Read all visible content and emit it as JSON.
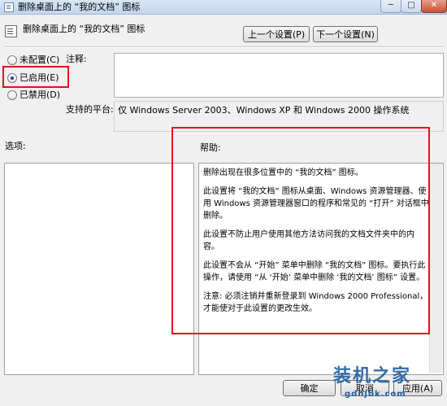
{
  "window": {
    "title": "删除桌面上的 “我的文档” 图标",
    "min_glyph": "─",
    "max_glyph": "□",
    "close_glyph": "✕"
  },
  "header": {
    "title": "删除桌面上的 “我的文档” 图标",
    "prev_label": "上一个设置(P)",
    "next_label": "下一个设置(N)"
  },
  "radios": [
    {
      "label": "未配置(C)",
      "selected": false
    },
    {
      "label": "已启用(E)",
      "selected": true
    },
    {
      "label": "已禁用(D)",
      "selected": false
    }
  ],
  "comment": {
    "label": "注释:",
    "value": ""
  },
  "platform": {
    "label": "支持的平台:",
    "value": "仅 Windows Server 2003、Windows XP 和 Windows 2000 操作系统"
  },
  "options": {
    "label": "选项:"
  },
  "help": {
    "label": "帮助:",
    "paragraphs": [
      "删除出现在很多位置中的 “我的文档” 图标。",
      "此设置将 “我的文档” 图标从桌面、Windows 资源管理器、使用 Windows 资源管理器窗口的程序和常见的 “打开” 对话框中删除。",
      "此设置不防止用户使用其他方法访问我的文档文件夹中的内容。",
      "此设置不会从 “开始” 菜单中删除 “我的文档” 图标。要执行此操作，请使用 “从 ‘开始’ 菜单中删除 ‘我的文档’ 图标” 设置。",
      "注意: 必须注销并重新登录到 Windows 2000 Professional，才能使对于此设置的更改生效。"
    ]
  },
  "footer": {
    "ok_label": "确定",
    "cancel_label": "取消",
    "apply_label": "应用(A)"
  },
  "watermark": {
    "text": "装机之家",
    "url": "gdnjbk.com"
  },
  "colors": {
    "highlight": "#e60f1b",
    "watermark": "#1f5f9e"
  }
}
